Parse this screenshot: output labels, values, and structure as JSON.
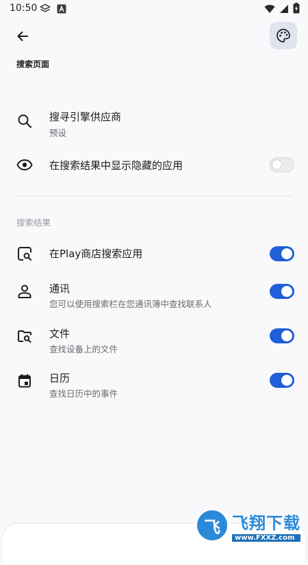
{
  "status_bar": {
    "time": "10:50"
  },
  "page": {
    "title": "搜索页面"
  },
  "settings": {
    "engine": {
      "title": "搜寻引擎供应商",
      "subtitle": "预设"
    },
    "hidden_apps": {
      "title": "在搜索结果中显示隐藏的应用",
      "enabled": false
    }
  },
  "results_section": {
    "label": "搜索结果",
    "items": [
      {
        "title": "在Play商店搜索应用",
        "subtitle": "",
        "enabled": true,
        "icon": "play-search-icon"
      },
      {
        "title": "通讯",
        "subtitle": "您可以使用搜索栏在您通讯簿中查找联系人",
        "enabled": true,
        "icon": "person-icon"
      },
      {
        "title": "文件",
        "subtitle": "查找设备上的文件",
        "enabled": true,
        "icon": "folder-search-icon"
      },
      {
        "title": "日历",
        "subtitle": "查找日历中的事件",
        "enabled": true,
        "icon": "calendar-icon"
      }
    ]
  },
  "watermark": {
    "logo_glyph": "飞",
    "title": "飞翔下载",
    "url": "www.FXXZ.com"
  },
  "colors": {
    "accent": "#1f5fd8",
    "palette_bg": "#dfe4ee",
    "background": "#f9f9fb"
  }
}
